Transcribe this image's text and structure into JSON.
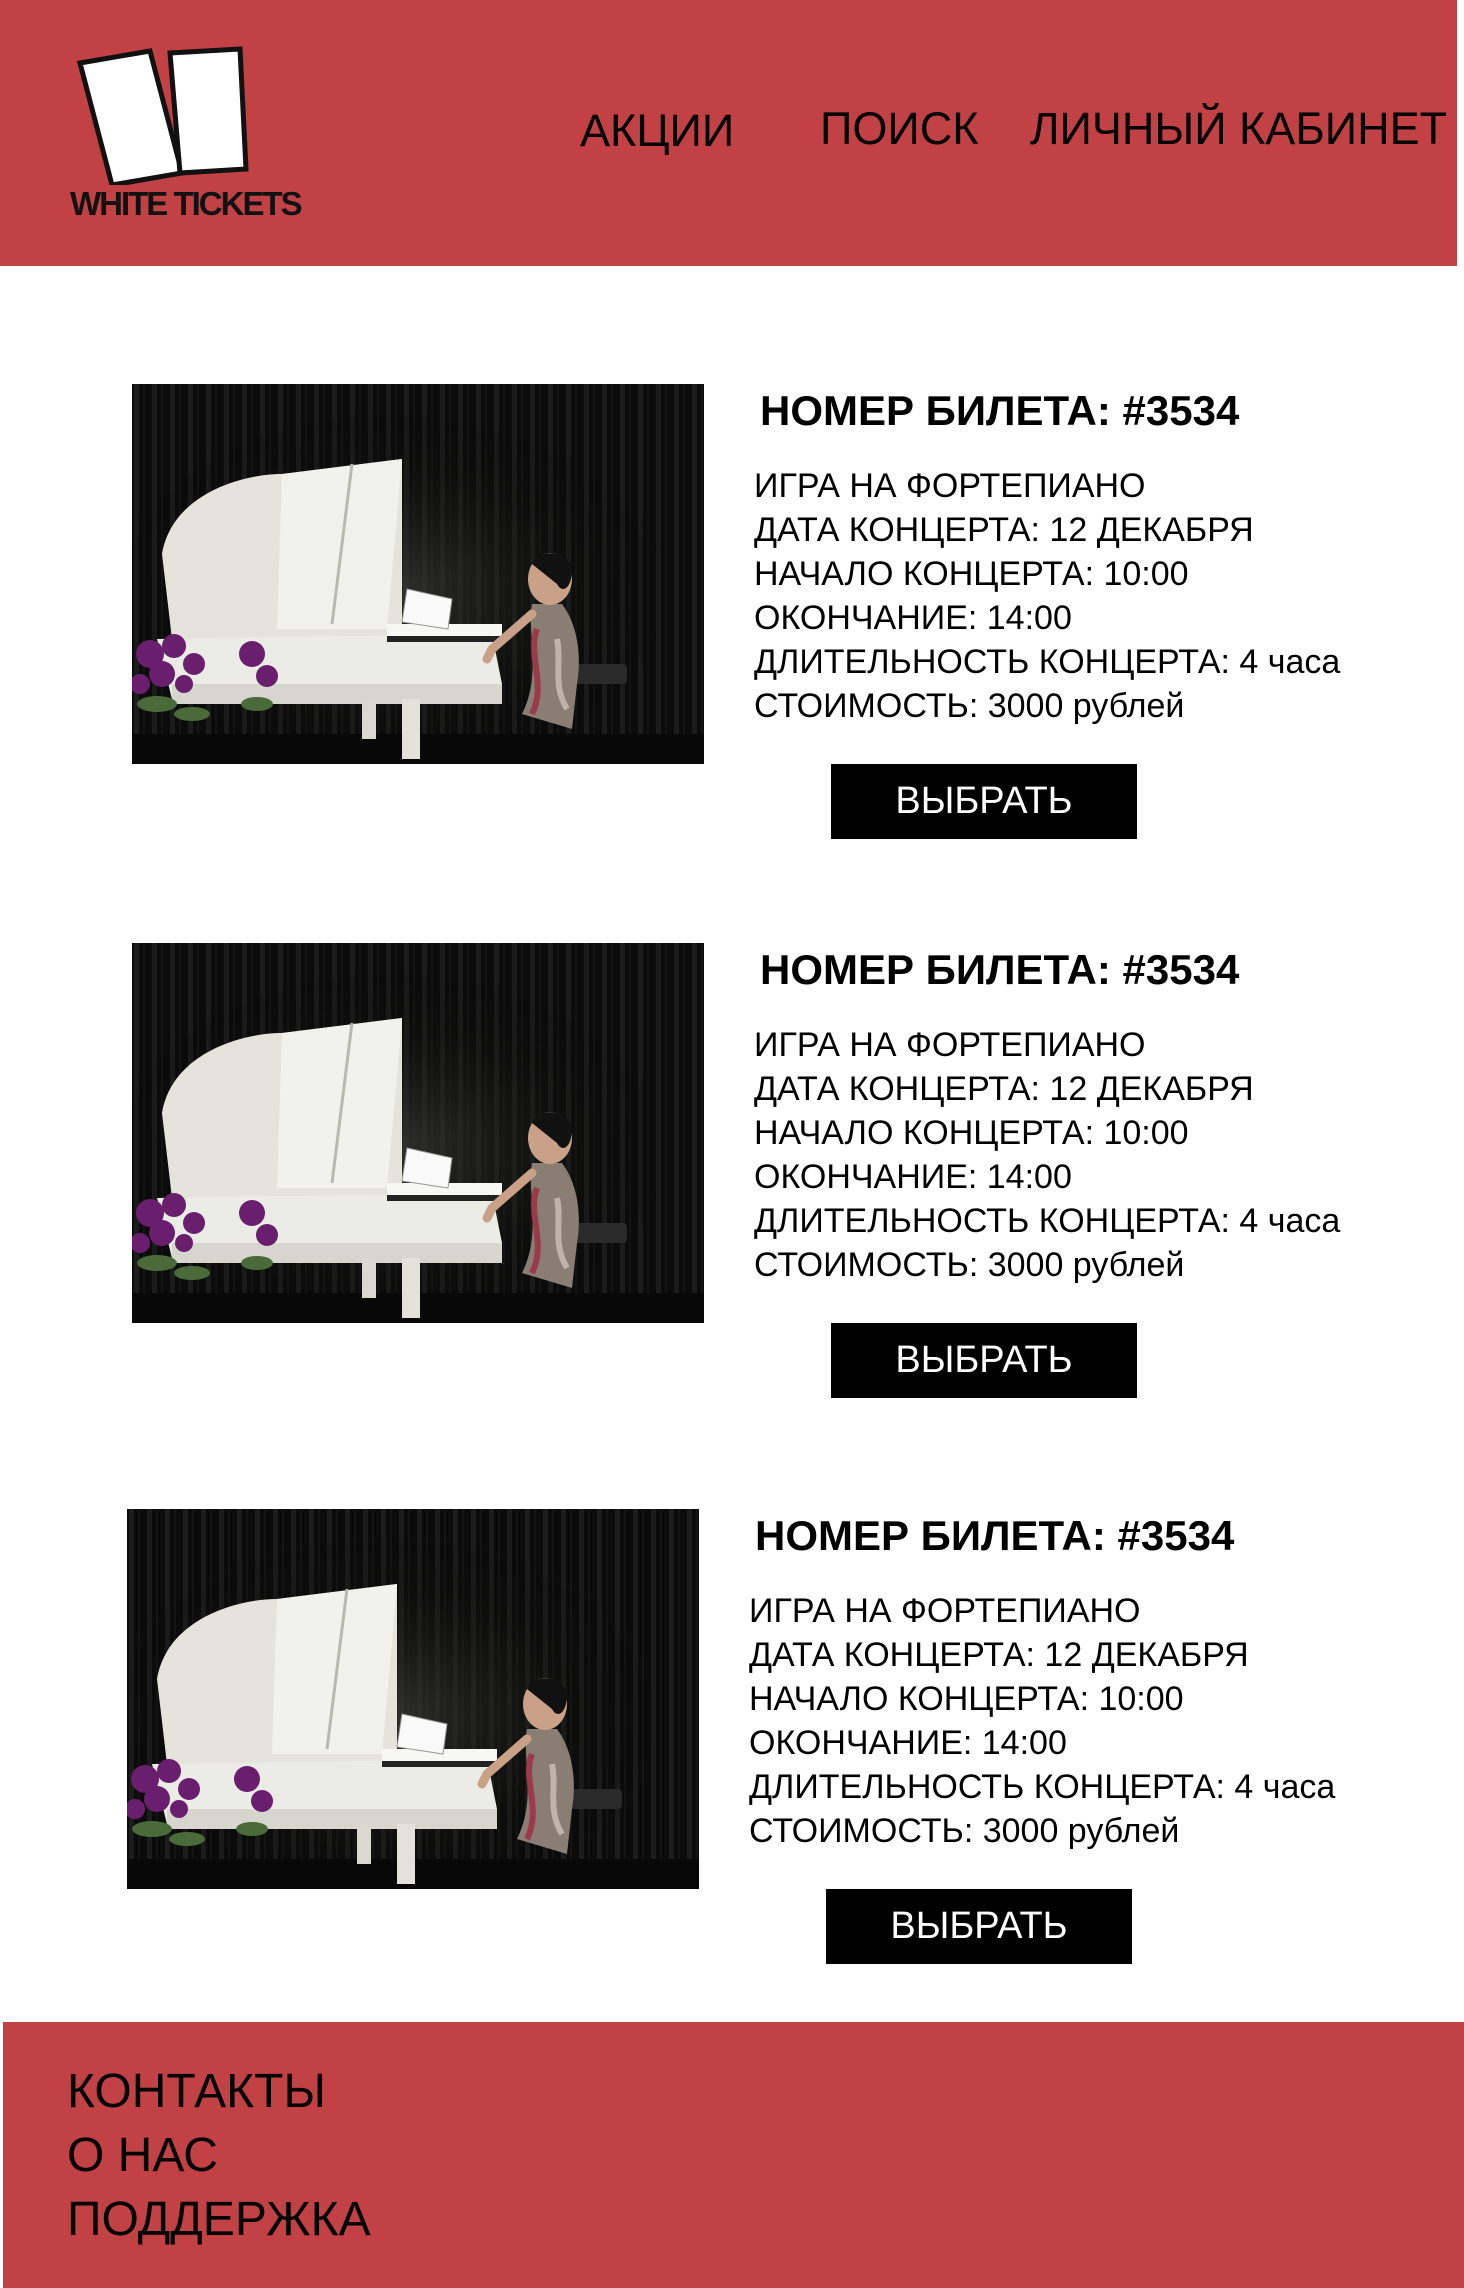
{
  "header": {
    "logo_text": "WHITE TICKETS",
    "nav": {
      "promos": "АКЦИИ",
      "search": "ПОИСК",
      "account": "ЛИЧНЫЙ КАБИНЕТ"
    }
  },
  "tickets": [
    {
      "title": "НОМЕР БИЛЕТА: #3534",
      "details": [
        "ИГРА НА ФОРТЕПИАНО",
        "ДАТА КОНЦЕРТА: 12 ДЕКАБРЯ",
        "НАЧАЛО КОНЦЕРТА: 10:00",
        "ОКОНЧАНИЕ: 14:00",
        "ДЛИТЕЛЬНОСТЬ КОНЦЕРТА: 4 часа",
        "СТОИМОСТЬ: 3000 рублей"
      ],
      "button": "ВЫБРАТЬ"
    },
    {
      "title": "НОМЕР БИЛЕТА: #3534",
      "details": [
        "ИГРА НА ФОРТЕПИАНО",
        "ДАТА КОНЦЕРТА: 12 ДЕКАБРЯ",
        "НАЧАЛО КОНЦЕРТА: 10:00",
        "ОКОНЧАНИЕ: 14:00",
        "ДЛИТЕЛЬНОСТЬ КОНЦЕРТА: 4 часа",
        "СТОИМОСТЬ: 3000 рублей"
      ],
      "button": "ВЫБРАТЬ"
    },
    {
      "title": "НОМЕР БИЛЕТА: #3534",
      "details": [
        "ИГРА НА ФОРТЕПИАНО",
        "ДАТА КОНЦЕРТА: 12 ДЕКАБРЯ",
        "НАЧАЛО КОНЦЕРТА: 10:00",
        "ОКОНЧАНИЕ: 14:00",
        "ДЛИТЕЛЬНОСТЬ КОНЦЕРТА: 4 часа",
        "СТОИМОСТЬ: 3000 рублей"
      ],
      "button": "ВЫБРАТЬ"
    }
  ],
  "footer": {
    "contacts": "КОНТАКТЫ",
    "about": "О НАС",
    "support": "ПОДДЕРЖКА"
  },
  "colors": {
    "brand_red": "#c14144",
    "button_bg": "#000000",
    "button_text": "#ffffff"
  }
}
